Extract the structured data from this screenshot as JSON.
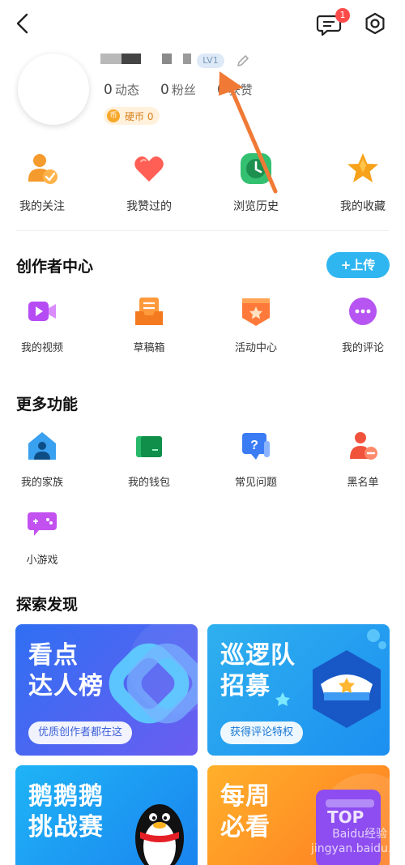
{
  "header": {
    "notification_count": "1",
    "level": "LV1"
  },
  "profile": {
    "stats": [
      {
        "count": "0",
        "label": "动态"
      },
      {
        "count": "0",
        "label": "粉丝"
      },
      {
        "count": "0",
        "label": "获赞"
      }
    ],
    "coin_label": "硬币 0",
    "coin_icon_text": "币"
  },
  "quick_actions": [
    {
      "label": "我的关注",
      "icon": "user-follow-icon"
    },
    {
      "label": "我赞过的",
      "icon": "heart-icon"
    },
    {
      "label": "浏览历史",
      "icon": "clock-history-icon"
    },
    {
      "label": "我的收藏",
      "icon": "star-icon"
    }
  ],
  "creator_center": {
    "title": "创作者中心",
    "upload_label": "+上传",
    "items": [
      {
        "label": "我的视频",
        "icon": "video-camera-icon"
      },
      {
        "label": "草稿箱",
        "icon": "drafts-icon"
      },
      {
        "label": "活动中心",
        "icon": "activity-badge-icon"
      },
      {
        "label": "我的评论",
        "icon": "comment-dots-icon"
      }
    ]
  },
  "more_features": {
    "title": "更多功能",
    "items": [
      {
        "label": "我的家族",
        "icon": "family-house-icon"
      },
      {
        "label": "我的钱包",
        "icon": "wallet-icon"
      },
      {
        "label": "常见问题",
        "icon": "faq-icon"
      },
      {
        "label": "黑名单",
        "icon": "blocklist-icon"
      },
      {
        "label": "小游戏",
        "icon": "gamepad-icon"
      }
    ]
  },
  "explore": {
    "title": "探索发现",
    "cards": [
      {
        "title_line1": "看点",
        "title_line2": "达人榜",
        "pill": "优质创作者都在这"
      },
      {
        "title_line1": "巡逻队",
        "title_line2": "招募",
        "pill": "获得评论特权"
      },
      {
        "title_line1": "鹅鹅鹅",
        "title_line2": "挑战赛"
      },
      {
        "title_line1": "每周",
        "title_line2": "必看",
        "badge": "TOP"
      }
    ]
  },
  "watermark": "Baidu经验 jingyan.baidu.com",
  "colors": {
    "accent_blue": "#2fb6f0",
    "arrow_orange": "#f07a35",
    "badge_red": "#ff4a4a",
    "coin_orange": "#f7a829"
  }
}
